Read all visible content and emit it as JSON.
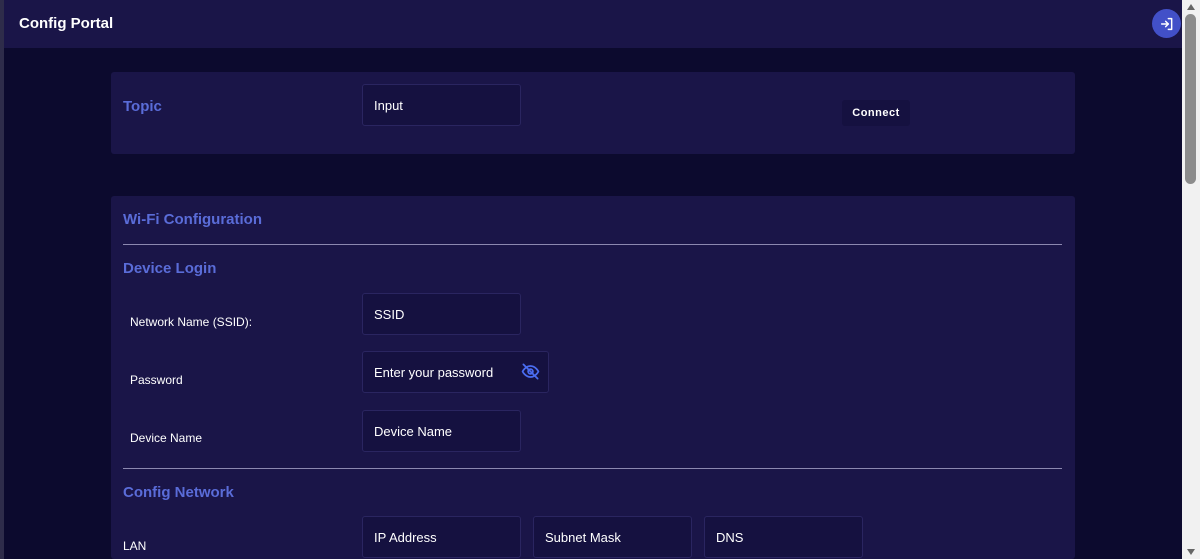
{
  "app": {
    "title": "Config Portal",
    "logout_icon": "logout-icon"
  },
  "topic": {
    "title": "Topic",
    "input_value": "Input",
    "connect_label": "Connect"
  },
  "wifi": {
    "title": "Wi-Fi Configuration",
    "device_login": {
      "title": "Device Login",
      "ssid_label": "Network Name (SSID):",
      "ssid_value": "SSID",
      "password_label": "Password",
      "password_placeholder": "Enter your password",
      "device_name_label": "Device Name",
      "device_name_value": "Device Name"
    },
    "config_network": {
      "title": "Config Network",
      "lan_label": "LAN",
      "ip_value": "IP Address",
      "subnet_value": "Subnet Mask",
      "dns_value": "DNS"
    }
  },
  "colors": {
    "background": "#0c0a2e",
    "card": "#1a1548",
    "accent": "#5a6cd8",
    "button": "#4250c8"
  }
}
